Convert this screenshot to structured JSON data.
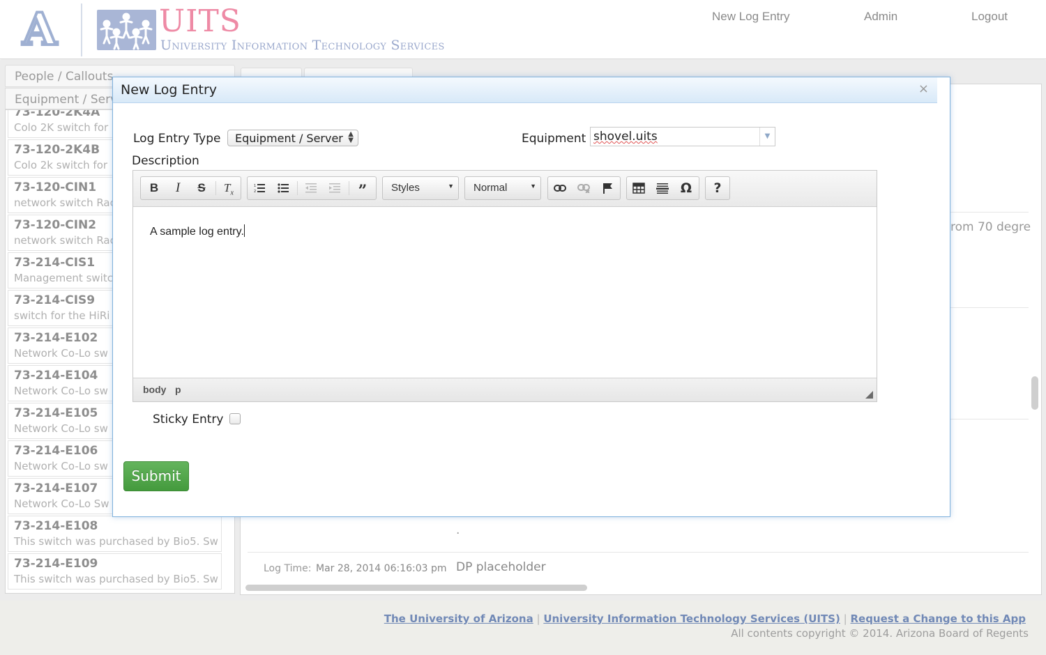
{
  "header": {
    "logo_letter": "A",
    "uits_title": "UITS",
    "uits_subtitle": "University Information Technology Services",
    "nav": [
      "New Log Entry",
      "Admin",
      "Logout"
    ]
  },
  "left": {
    "tab_people": "People / Callouts",
    "tab_equipment": "Equipment / Serv",
    "items": [
      {
        "name": "73-120-2K4A",
        "desc": "Colo 2K switch for"
      },
      {
        "name": "73-120-2K4B",
        "desc": "Colo 2k switch for"
      },
      {
        "name": "73-120-CIN1",
        "desc": "network switch Rac"
      },
      {
        "name": "73-120-CIN2",
        "desc": "network switch Rac"
      },
      {
        "name": "73-214-CIS1",
        "desc": "Management switc"
      },
      {
        "name": "73-214-CIS9",
        "desc": "switch for the HiRi"
      },
      {
        "name": "73-214-E102",
        "desc": "Network Co-Lo sw"
      },
      {
        "name": "73-214-E104",
        "desc": "Network Co-Lo sw"
      },
      {
        "name": "73-214-E105",
        "desc": "Network Co-Lo sw"
      },
      {
        "name": "73-214-E106",
        "desc": "Network Co-Lo sw"
      },
      {
        "name": "73-214-E107",
        "desc": "Network Co-Lo Sw"
      },
      {
        "name": "73-214-E108",
        "desc": "This switch was purchased by Bio5. Sw"
      },
      {
        "name": "73-214-E109",
        "desc": "This switch was purchased by Bio5. Sw"
      }
    ]
  },
  "background": {
    "partial_text": "rom 70 degre",
    "dot": ".",
    "log_time_label": "Log Time:",
    "log_time_value": "Mar 28, 2014 06:16:03 pm",
    "log_text": "DP placeholder"
  },
  "modal": {
    "title": "New Log Entry",
    "close": "×",
    "log_entry_type_label": "Log Entry Type",
    "log_entry_type_value": "Equipment / Server",
    "equipment_label": "Equipment",
    "equipment_value": "shovel.uits",
    "description_label": "Description",
    "toolbar": {
      "styles_label": "Styles",
      "format_label": "Normal"
    },
    "editor_text": "A sample log entry.",
    "path": [
      "body",
      "p"
    ],
    "sticky_label": "Sticky Entry",
    "sticky_checked": false,
    "submit_label": "Submit"
  },
  "footer": {
    "links": [
      "The University of Arizona",
      "University Information Technology Services (UITS)",
      "Request a Change to this App"
    ],
    "separator": "|",
    "copyright": "All contents copyright © 2014. Arizona Board of Regents"
  },
  "colors": {
    "accent_pink": "#ee8aa5",
    "accent_blue": "#9aa8cc",
    "submit_green": "#4ea847",
    "link_blue": "#7189b6"
  }
}
